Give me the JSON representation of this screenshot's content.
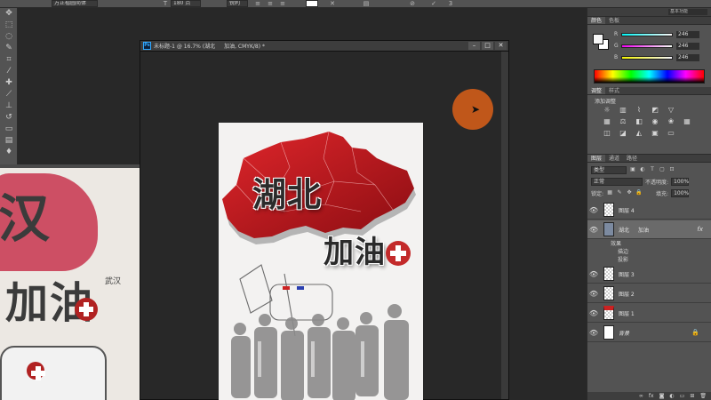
{
  "options_bar": {
    "mode_value": "万正楷圆简体",
    "size_value": "180 点",
    "aa_value": "锐利"
  },
  "toolbar": {
    "tools": [
      {
        "name": "move-tool",
        "glyph": "✥"
      },
      {
        "name": "marquee-tool",
        "glyph": "⬚"
      },
      {
        "name": "lasso-tool",
        "glyph": "◌"
      },
      {
        "name": "quick-select-tool",
        "glyph": "✎"
      },
      {
        "name": "crop-tool",
        "glyph": "⌗"
      },
      {
        "name": "eyedropper-tool",
        "glyph": "⁄"
      },
      {
        "name": "healing-tool",
        "glyph": "✚"
      },
      {
        "name": "brush-tool",
        "glyph": "⟋"
      },
      {
        "name": "stamp-tool",
        "glyph": "⊥"
      },
      {
        "name": "history-brush-tool",
        "glyph": "↺"
      },
      {
        "name": "eraser-tool",
        "glyph": "▭"
      },
      {
        "name": "gradient-tool",
        "glyph": "▤"
      },
      {
        "name": "blur-tool",
        "glyph": "♦"
      }
    ]
  },
  "document": {
    "title": "未标题-1 @ 16.7% (湖北",
    "title_layer": "加油, CMYK/8) *",
    "badge": "Ps",
    "poster": {
      "line1": "湖北",
      "line2": "加油"
    }
  },
  "back_photo": {
    "char1": "汉",
    "char2": "加油",
    "small": "武汉"
  },
  "workspace_switcher": "基本功能",
  "color_panel": {
    "tabs": [
      "颜色",
      "色板"
    ],
    "channels": [
      {
        "label": "R",
        "value": "246"
      },
      {
        "label": "G",
        "value": "246"
      },
      {
        "label": "B",
        "value": "246"
      }
    ],
    "accent_fg": "#f6f6f6"
  },
  "adjust_panel": {
    "tabs": [
      "调整",
      "样式"
    ],
    "title": "添加调整"
  },
  "layers_panel": {
    "tabs": [
      "图层",
      "通道",
      "路径"
    ],
    "filter_label": "类型",
    "blend_mode": "正常",
    "opacity_label": "不透明度:",
    "opacity_value": "100%",
    "lock_label": "锁定:",
    "fill_label": "填充:",
    "fill_value": "100%",
    "layers": [
      {
        "name": "图层 4",
        "thumb": "checker"
      },
      {
        "name": "湖北",
        "name2": "加油",
        "fx": "fx",
        "thumb": "text"
      },
      {
        "name": "图层 3",
        "thumb": "checker"
      },
      {
        "name": "图层 2",
        "thumb": "checker"
      },
      {
        "name": "图层 1",
        "thumb": "red"
      },
      {
        "name": "背景",
        "thumb": "white",
        "lock": "🔒"
      }
    ],
    "effects": {
      "label": "效果",
      "stroke": "描边",
      "shadow": "投影"
    }
  }
}
